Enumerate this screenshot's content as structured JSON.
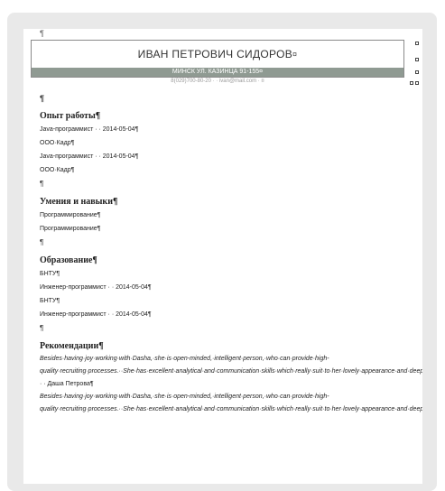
{
  "document": {
    "top_mark": "¶",
    "name": "ИВАН ПЕТРОВИЧ СИДОРОВ",
    "name_mark": "¤",
    "address": "МИНСК УЛ. КАЗИНЦА 91-155¤",
    "contact": "8(029)700-80-20 · · ivan@mail.com · ¤",
    "spacer_mark": "¶"
  },
  "experience": {
    "title": "Опыт работы¶",
    "lines": [
      "Java-программист · · 2014-05-04¶",
      "ООО·Кадр¶",
      "Java-программист · · 2014-05-04¶",
      "ООО·Кадр¶"
    ],
    "end_mark": "¶"
  },
  "skills": {
    "title": "Умения и навыки¶",
    "lines": [
      "Программирование¶",
      "Программирование¶"
    ],
    "end_mark": "¶"
  },
  "education": {
    "title": "Образование¶",
    "lines": [
      "БНТУ¶",
      "Инженер-программист · · 2014-05-04¶",
      "БНТУ¶",
      "Инженер-программист · · 2014-05-04¶"
    ],
    "end_mark": "¶"
  },
  "recommendations": {
    "title": "Рекомендации¶",
    "text_1": "Besides·having·joy·working·with·Dasha,·she·is·open-minded,·intelligent·person,·who·can·provide·high-quality·recruiting·processes.··She·has·excellent·analytical·and·communication·skills·which·really·suit·to·her·lovely·appearance·and·deep·inside·world.·I·extremely·recommended·Dasha·as·talented·recruiter.",
    "signature_1": " · · Даша Петрова¶",
    "text_2": "Besides·having·joy·working·with·Dasha,·she·is·open-minded,·intelligent·person,·who·can·provide·high-quality·recruiting·processes.··She·has·excellent·analytical·and·communication·skills·which·really·suit·to·her·lovely·appearance·and·deep·inside·world.·I·extremely·recommended·Dasha·as·"
  }
}
